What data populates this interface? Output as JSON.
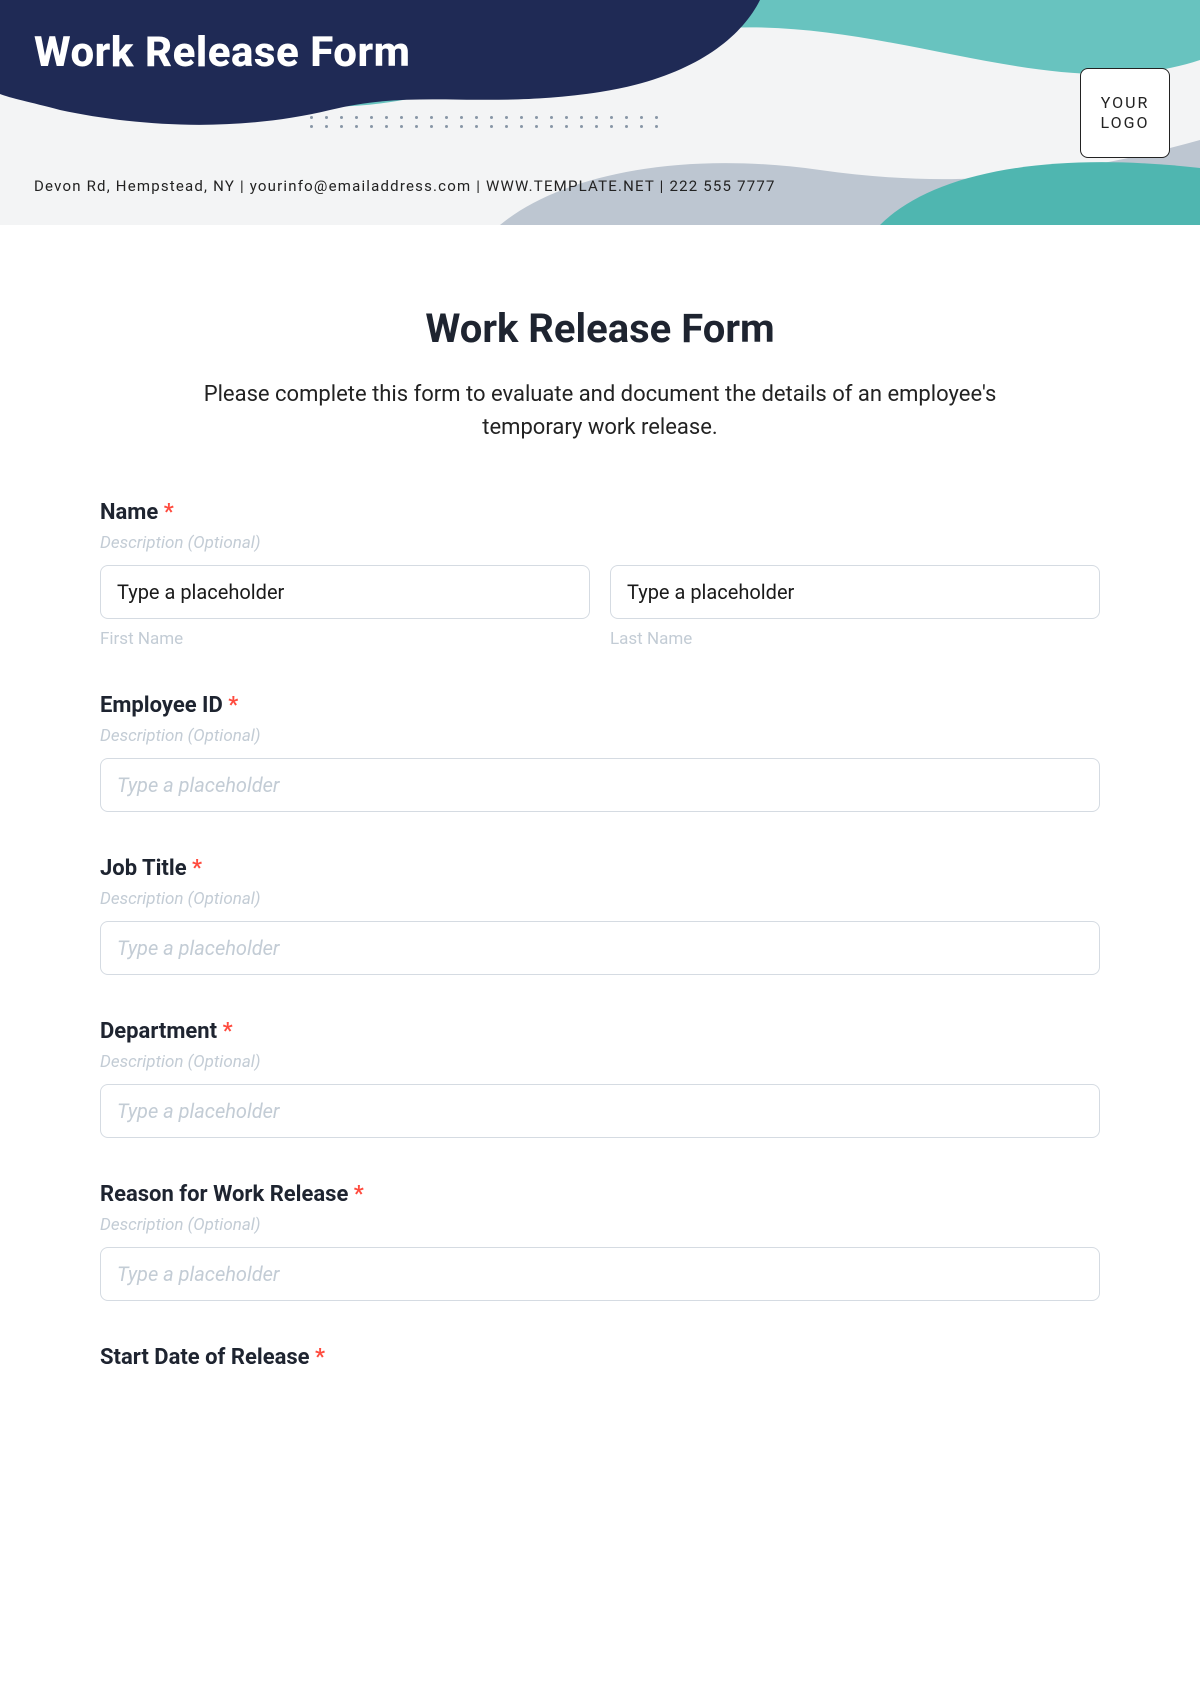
{
  "header": {
    "title": "Work Release Form",
    "logo_text": "YOUR LOGO",
    "contact": "Devon Rd, Hempstead, NY | yourinfo@emailaddress.com | WWW.TEMPLATE.NET | 222 555 7777"
  },
  "form": {
    "title": "Work Release Form",
    "description": "Please complete this form to evaluate and document the details of an employee's temporary work release.",
    "required_marker": "*",
    "fields": {
      "name": {
        "label": "Name",
        "hint": "Description (Optional)",
        "first_placeholder": "Type a placeholder",
        "first_sub": "First Name",
        "last_placeholder": "Type a placeholder",
        "last_sub": "Last Name"
      },
      "employee_id": {
        "label": "Employee ID",
        "hint": "Description (Optional)",
        "placeholder": "Type a placeholder"
      },
      "job_title": {
        "label": "Job Title",
        "hint": "Description (Optional)",
        "placeholder": "Type a placeholder"
      },
      "department": {
        "label": "Department",
        "hint": "Description (Optional)",
        "placeholder": "Type a placeholder"
      },
      "reason": {
        "label": "Reason for Work Release",
        "hint": "Description (Optional)",
        "placeholder": "Type a placeholder"
      },
      "start_date": {
        "label": "Start Date of Release"
      }
    }
  },
  "colors": {
    "navy": "#1f2a55",
    "teal_light": "#6cc4c0",
    "teal": "#2fa6a0",
    "slate": "#8896a6",
    "required": "#ff4b3e"
  }
}
